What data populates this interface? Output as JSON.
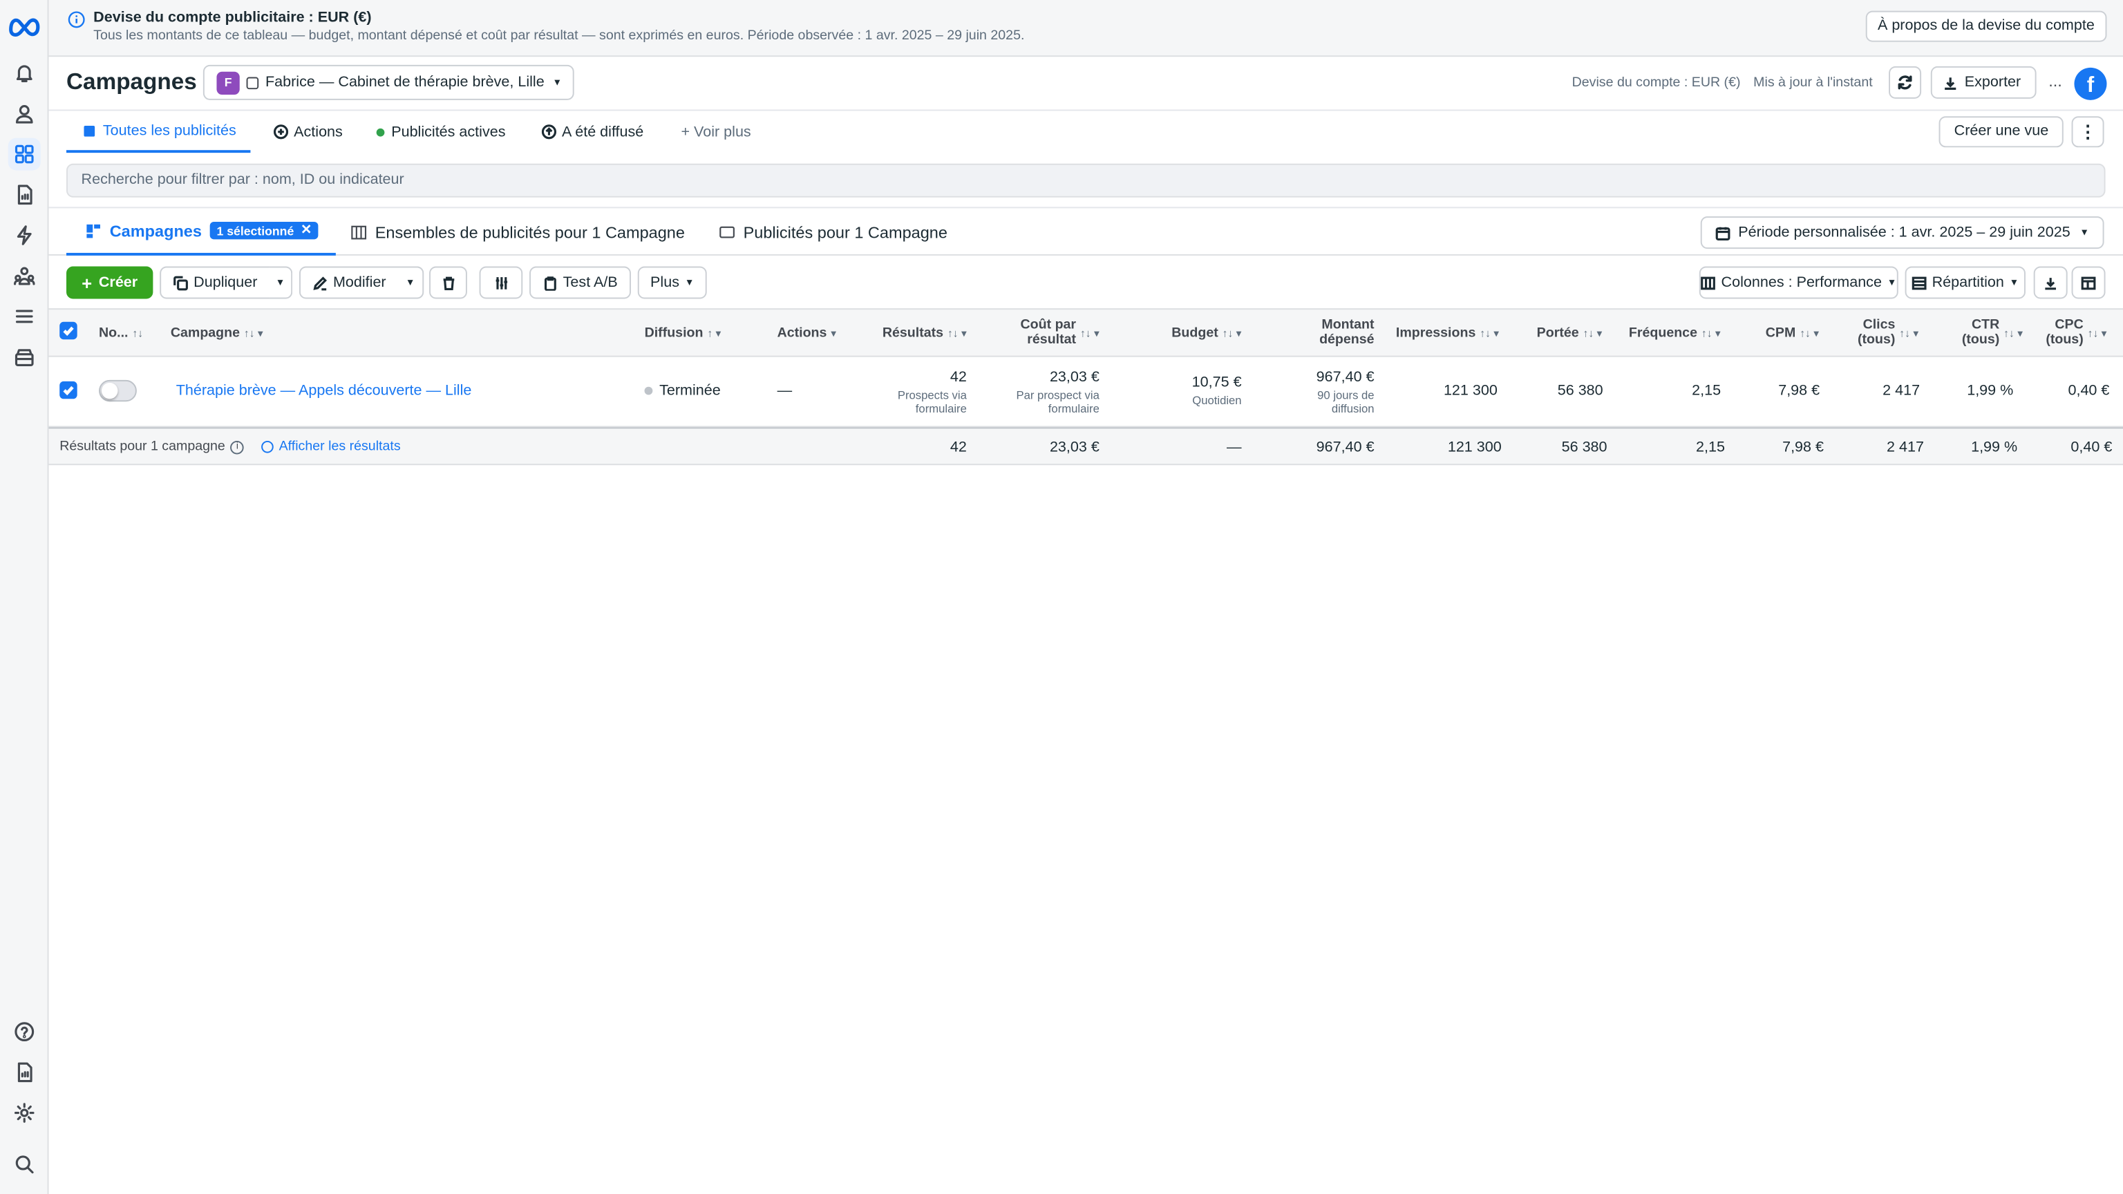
{
  "banner": {
    "title": "Devise du compte publicitaire : EUR (€)",
    "text": "Tous les montants de ce tableau — budget, montant dépensé et coût par résultat — sont exprimés en euros. Période observée : 1 avr. 2025 – 29 juin 2025.",
    "button": "À propos de la devise du compte"
  },
  "header": {
    "title": "Campagnes",
    "account_initial": "F",
    "account_name": "Fabrice — Cabinet de thérapie brève, Lille",
    "currency_note": "Devise du compte : EUR (€)",
    "updated": "Mis à jour à l'instant",
    "export": "Exporter",
    "more": "..."
  },
  "views": {
    "tabs": [
      "Toutes les publicités",
      "Actions",
      "Publicités actives",
      "A été diffusé",
      "+ Voir plus"
    ],
    "create_view": "Créer une vue"
  },
  "search": {
    "placeholder": "Recherche pour filtrer par : nom, ID ou indicateur"
  },
  "levels": {
    "campaigns": "Campagnes",
    "selected_badge": "1 sélectionné",
    "adsets": "Ensembles de publicités pour 1 Campagne",
    "ads": "Publicités pour 1 Campagne",
    "date_range": "Période personnalisée : 1 avr. 2025 – 29 juin 2025"
  },
  "toolbar": {
    "create": "Créer",
    "duplicate": "Dupliquer",
    "edit": "Modifier",
    "ab_test": "Test A/B",
    "more": "Plus",
    "columns": "Colonnes : Performance",
    "breakdown": "Répartition"
  },
  "table": {
    "headers": {
      "name": "No...",
      "campaign": "Campagne",
      "delivery": "Diffusion",
      "actions": "Actions",
      "results": "Résultats",
      "cost_per_result_1": "Coût par",
      "cost_per_result_2": "résultat",
      "budget": "Budget",
      "spent_1": "Montant",
      "spent_2": "dépensé",
      "impressions": "Impressions",
      "reach": "Portée",
      "frequency": "Fréquence",
      "cpm": "CPM",
      "clicks_1": "Clics",
      "clicks_2": "(tous)",
      "ctr_1": "CTR",
      "ctr_2": "(tous)",
      "cpc_1": "CPC",
      "cpc_2": "(tous)"
    },
    "row": {
      "campaign": "Thérapie brève — Appels découverte — Lille",
      "delivery": "Terminée",
      "actions": "—",
      "results": "42",
      "results_sub_1": "Prospects via",
      "results_sub_2": "formulaire",
      "cost_per_result": "23,03 €",
      "cpr_sub_1": "Par prospect via",
      "cpr_sub_2": "formulaire",
      "budget": "10,75 €",
      "budget_sub": "Quotidien",
      "spent": "967,40 €",
      "spent_sub_1": "90 jours de",
      "spent_sub_2": "diffusion",
      "impressions": "121 300",
      "reach": "56 380",
      "frequency": "2,15",
      "cpm": "7,98 €",
      "clicks": "2 417",
      "ctr": "1,99 %",
      "cpc": "0,40 €"
    },
    "footer": {
      "label": "Résultats pour 1 campagne",
      "show_results": "Afficher les résultats",
      "results": "42",
      "cost_per_result": "23,03 €",
      "budget": "—",
      "spent": "967,40 €",
      "impressions": "121 300",
      "reach": "56 380",
      "frequency": "2,15",
      "cpm": "7,98 €",
      "clicks": "2 417",
      "ctr": "1,99 %",
      "cpc": "0,40 €"
    }
  },
  "colors": {
    "accent": "#1877f2",
    "create_green": "#36a420",
    "active_dot": "#31a24c"
  }
}
